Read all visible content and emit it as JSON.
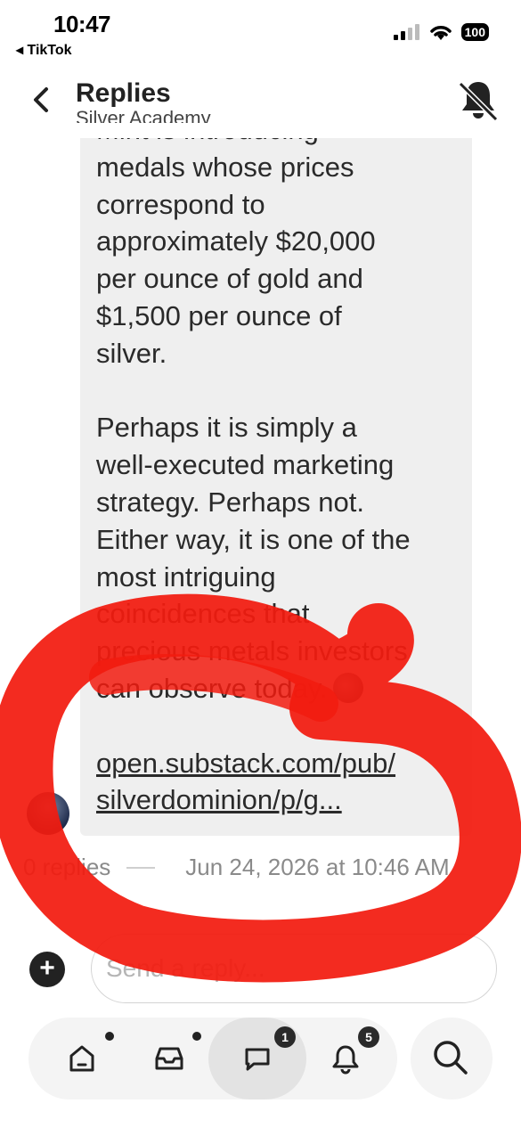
{
  "status_bar": {
    "time": "10:47",
    "back_app": "◂ TikTok",
    "battery": "100"
  },
  "header": {
    "title": "Replies",
    "subtitle": "Silver Academy"
  },
  "message": {
    "lines_para1": [
      "Mint is introducing",
      "medals whose prices",
      "correspond to",
      "approximately $20,000",
      "per ounce of gold and",
      "$1,500 per ounce of",
      "silver."
    ],
    "lines_para2": [
      "Perhaps it is simply a",
      "well-executed marketing",
      "strategy. Perhaps not.",
      "Either way, it is one of the",
      "most intriguing",
      "coincidences that",
      "precious metals investors"
    ],
    "last_line": "can observe today.",
    "link_line1": "open.substack.com/pub/",
    "link_line2": "silverdominion/p/g..."
  },
  "meta": {
    "replies": "0 replies",
    "timestamp": "Jun 24, 2026 at 10:46 AM"
  },
  "reply_box": {
    "placeholder": "Send a reply..."
  },
  "nav": {
    "messages_badge": "1",
    "notifications_badge": "5"
  },
  "colors": {
    "annotation": "#f21b0f",
    "bubble": "#efefef"
  }
}
